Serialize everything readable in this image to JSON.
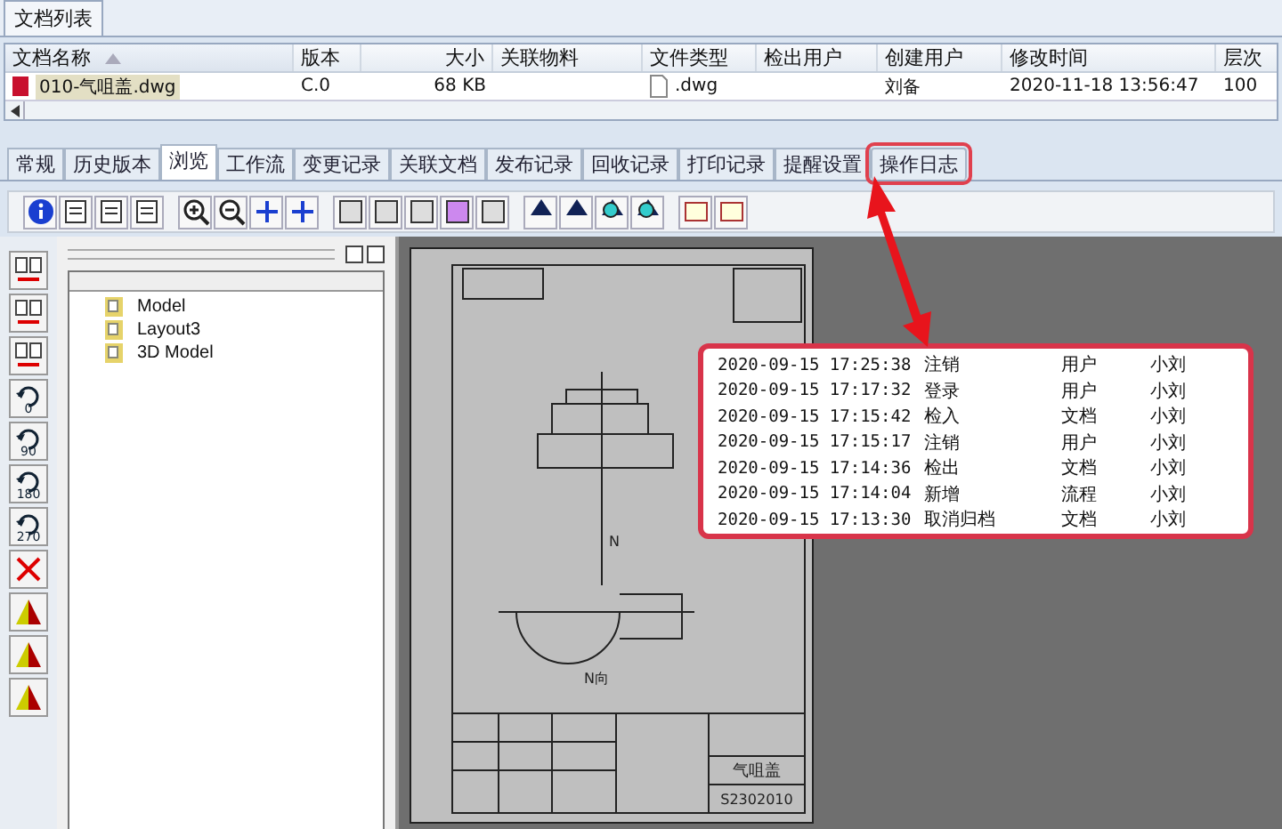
{
  "list_tab": {
    "label": "文档列表"
  },
  "table": {
    "columns": [
      {
        "label": "文档名称",
        "sorted": true
      },
      {
        "label": "版本"
      },
      {
        "label": "大小"
      },
      {
        "label": "关联物料"
      },
      {
        "label": "文件类型"
      },
      {
        "label": "检出用户"
      },
      {
        "label": "创建用户"
      },
      {
        "label": "修改时间"
      },
      {
        "label": "层次"
      }
    ],
    "rows": [
      {
        "selected": true,
        "cells": [
          "010-气咀盖.dwg",
          "C.0",
          "68 KB",
          "",
          ".dwg",
          "",
          "刘备",
          "2020-11-18 13:56:47",
          "100"
        ]
      }
    ]
  },
  "tabs": [
    {
      "label": "常规",
      "selected": false,
      "callout": false
    },
    {
      "label": "历史版本",
      "selected": false,
      "callout": false
    },
    {
      "label": "浏览",
      "selected": true,
      "callout": false
    },
    {
      "label": "工作流",
      "selected": false,
      "callout": false
    },
    {
      "label": "变更记录",
      "selected": false,
      "callout": false
    },
    {
      "label": "关联文档",
      "selected": false,
      "callout": false
    },
    {
      "label": "发布记录",
      "selected": false,
      "callout": false
    },
    {
      "label": "回收记录",
      "selected": false,
      "callout": false
    },
    {
      "label": "打印记录",
      "selected": false,
      "callout": false
    },
    {
      "label": "提醒设置",
      "selected": false,
      "callout": false
    },
    {
      "label": "操作日志",
      "selected": false,
      "callout": true
    }
  ],
  "rotate_tools": [
    "0",
    "90",
    "180",
    "270"
  ],
  "layouts": [
    {
      "label": "Model"
    },
    {
      "label": "Layout3"
    },
    {
      "label": "3D Model"
    }
  ],
  "drawing": {
    "view_label": "N",
    "view_caption": "N向",
    "part_name": "气咀盖",
    "drawing_number": "S2302010"
  },
  "log": [
    {
      "time": "2020-09-15  17:25:38",
      "action": "注销",
      "object": "用户",
      "user": "小刘"
    },
    {
      "time": "2020-09-15  17:17:32",
      "action": "登录",
      "object": "用户",
      "user": "小刘"
    },
    {
      "time": "2020-09-15  17:15:42",
      "action": "检入",
      "object": "文档",
      "user": "小刘"
    },
    {
      "time": "2020-09-15  17:15:17",
      "action": "注销",
      "object": "用户",
      "user": "小刘"
    },
    {
      "time": "2020-09-15  17:14:36",
      "action": "检出",
      "object": "文档",
      "user": "小刘"
    },
    {
      "time": "2020-09-15  17:14:04",
      "action": "新增",
      "object": "流程",
      "user": "小刘"
    },
    {
      "time": "2020-09-15  17:13:30",
      "action": "取消归档",
      "object": "文档",
      "user": "小刘"
    }
  ]
}
